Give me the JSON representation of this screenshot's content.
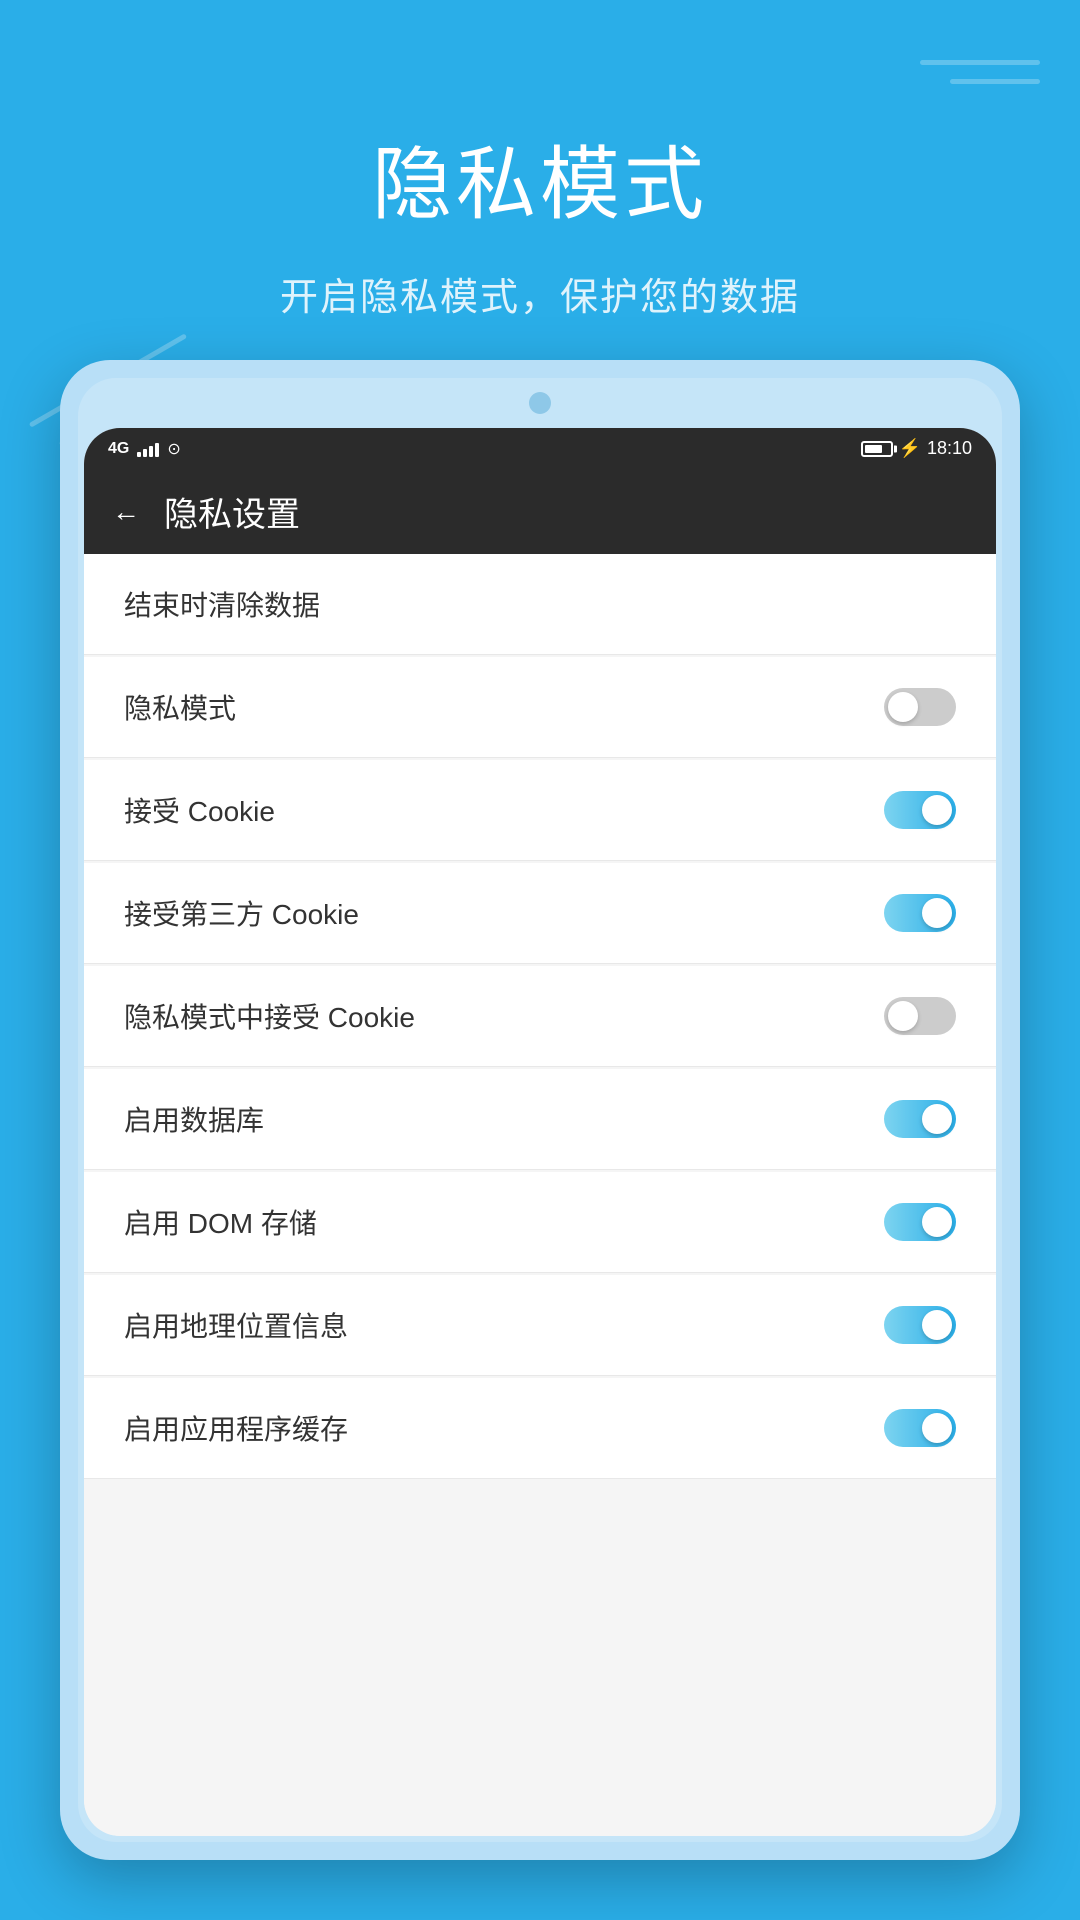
{
  "header": {
    "title": "隐私模式",
    "subtitle": "开启隐私模式，保护您的数据"
  },
  "status_bar": {
    "network": "4G",
    "time": "18:10",
    "battery": "71"
  },
  "nav": {
    "title": "隐私设置",
    "back_label": "←"
  },
  "settings": [
    {
      "id": "clear-on-exit",
      "label": "结束时清除数据",
      "has_toggle": false
    },
    {
      "id": "privacy-mode",
      "label": "隐私模式",
      "has_toggle": true,
      "on": false
    },
    {
      "id": "accept-cookie",
      "label": "接受 Cookie",
      "has_toggle": true,
      "on": true
    },
    {
      "id": "accept-third-cookie",
      "label": "接受第三方 Cookie",
      "has_toggle": true,
      "on": true
    },
    {
      "id": "privacy-cookie",
      "label": "隐私模式中接受 Cookie",
      "has_toggle": true,
      "on": false
    },
    {
      "id": "enable-db",
      "label": "启用数据库",
      "has_toggle": true,
      "on": true
    },
    {
      "id": "enable-dom",
      "label": "启用 DOM 存储",
      "has_toggle": true,
      "on": true
    },
    {
      "id": "enable-geo",
      "label": "启用地理位置信息",
      "has_toggle": true,
      "on": true
    },
    {
      "id": "enable-appcache",
      "label": "启用应用程序缓存",
      "has_toggle": true,
      "on": true
    }
  ]
}
